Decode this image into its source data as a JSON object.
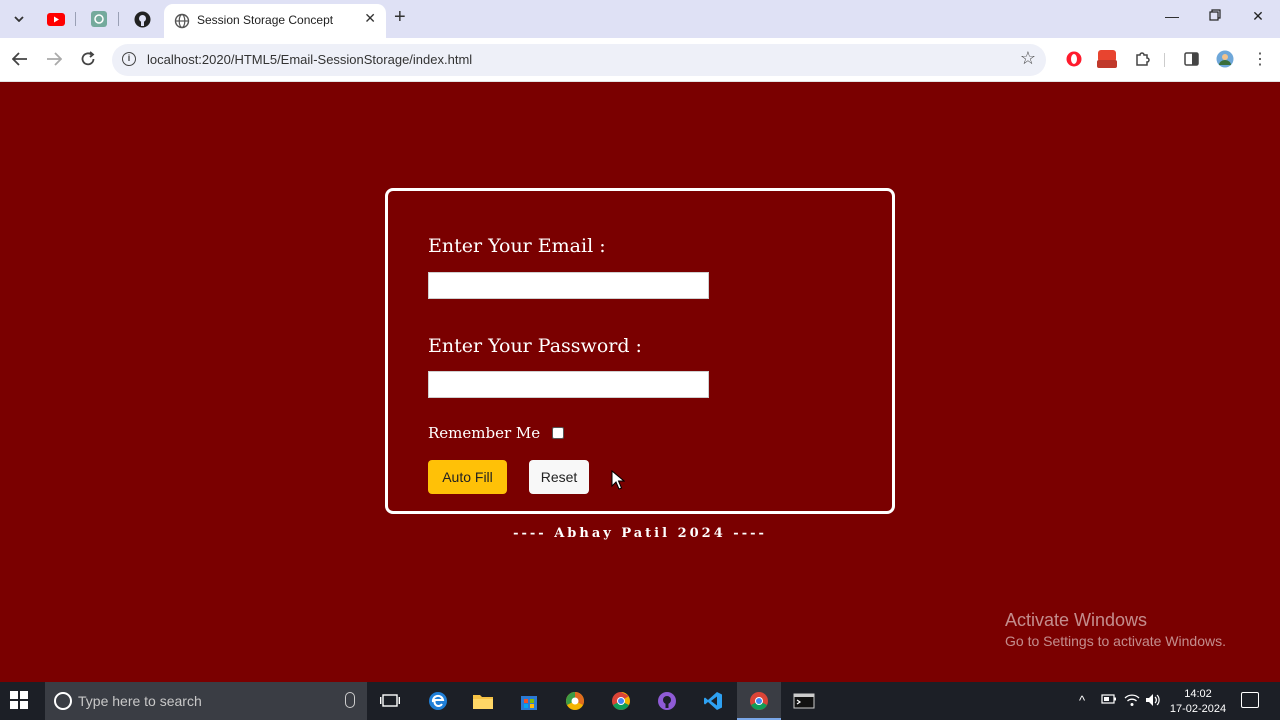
{
  "browser": {
    "tab_title": "Session Storage Concept",
    "url": "localhost:2020/HTML5/Email-SessionStorage/index.html",
    "extension_badge": "0:00"
  },
  "form": {
    "email_label": "Enter Your Email :",
    "email_value": "",
    "password_label": "Enter Your Password :",
    "password_value": "",
    "remember_label": "Remember Me",
    "remember_checked": false,
    "autofill_label": "Auto Fill",
    "reset_label": "Reset"
  },
  "footer": {
    "text": "---- Abhay Patil 2024 ----"
  },
  "watermark": {
    "line1": "Activate Windows",
    "line2": "Go to Settings to activate Windows."
  },
  "taskbar": {
    "search_placeholder": "Type here to search",
    "time": "14:02",
    "date": "17-02-2024"
  },
  "colors": {
    "page_background": "#7a0000",
    "autofill_button": "#ffc107",
    "tabstrip": "#dfe1f5"
  }
}
